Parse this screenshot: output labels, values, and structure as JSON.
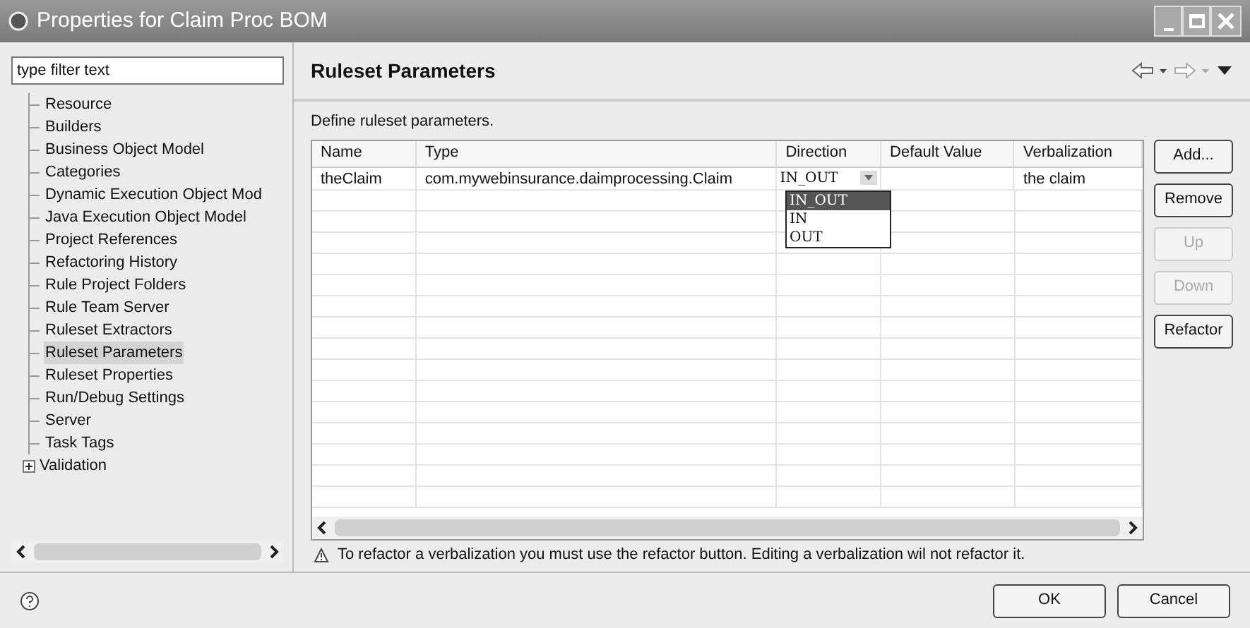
{
  "window": {
    "title": "Properties for Claim Proc BOM"
  },
  "filter": {
    "placeholder": "type filter text"
  },
  "tree": [
    {
      "label": "Resource",
      "selected": false,
      "kind": "leaf"
    },
    {
      "label": "Builders",
      "selected": false,
      "kind": "leaf"
    },
    {
      "label": "Business Object Model",
      "selected": false,
      "kind": "leaf"
    },
    {
      "label": "Categories",
      "selected": false,
      "kind": "leaf"
    },
    {
      "label": "Dynamic Execution Object Mod",
      "selected": false,
      "kind": "leaf"
    },
    {
      "label": "Java Execution Object Model",
      "selected": false,
      "kind": "leaf"
    },
    {
      "label": "Project References",
      "selected": false,
      "kind": "leaf"
    },
    {
      "label": "Refactoring History",
      "selected": false,
      "kind": "leaf"
    },
    {
      "label": "Rule Project Folders",
      "selected": false,
      "kind": "leaf"
    },
    {
      "label": "Rule Team Server",
      "selected": false,
      "kind": "leaf"
    },
    {
      "label": "Ruleset Extractors",
      "selected": false,
      "kind": "leaf"
    },
    {
      "label": "Ruleset Parameters",
      "selected": true,
      "kind": "leaf"
    },
    {
      "label": "Ruleset Properties",
      "selected": false,
      "kind": "leaf"
    },
    {
      "label": "Run/Debug Settings",
      "selected": false,
      "kind": "leaf"
    },
    {
      "label": "Server",
      "selected": false,
      "kind": "leaf"
    },
    {
      "label": "Task Tags",
      "selected": false,
      "kind": "leaf"
    },
    {
      "label": "Validation",
      "selected": false,
      "kind": "collapsed"
    }
  ],
  "page": {
    "title": "Ruleset Parameters",
    "description": "Define ruleset parameters."
  },
  "table": {
    "columns": [
      "Name",
      "Type",
      "Direction",
      "Default Value",
      "Verbalization"
    ],
    "rows": [
      {
        "name": "theClaim",
        "type": "com.mywebinsurance.daimprocessing.Claim",
        "direction": "IN_OUT",
        "default_value": "",
        "verbalization": "the claim"
      }
    ]
  },
  "direction_options": [
    {
      "label": "IN_OUT",
      "selected": true
    },
    {
      "label": "IN",
      "selected": false
    },
    {
      "label": "OUT",
      "selected": false
    }
  ],
  "side_buttons": [
    {
      "label": "Add...",
      "disabled": false
    },
    {
      "label": "Remove",
      "disabled": false
    },
    {
      "label": "Up",
      "disabled": true
    },
    {
      "label": "Down",
      "disabled": true
    },
    {
      "label": "Refactor",
      "disabled": false
    }
  ],
  "note": "To refactor a verbalization you must use the refactor button. Editing a verbalization wil not refactor it.",
  "footer_buttons": [
    "OK",
    "Cancel"
  ]
}
